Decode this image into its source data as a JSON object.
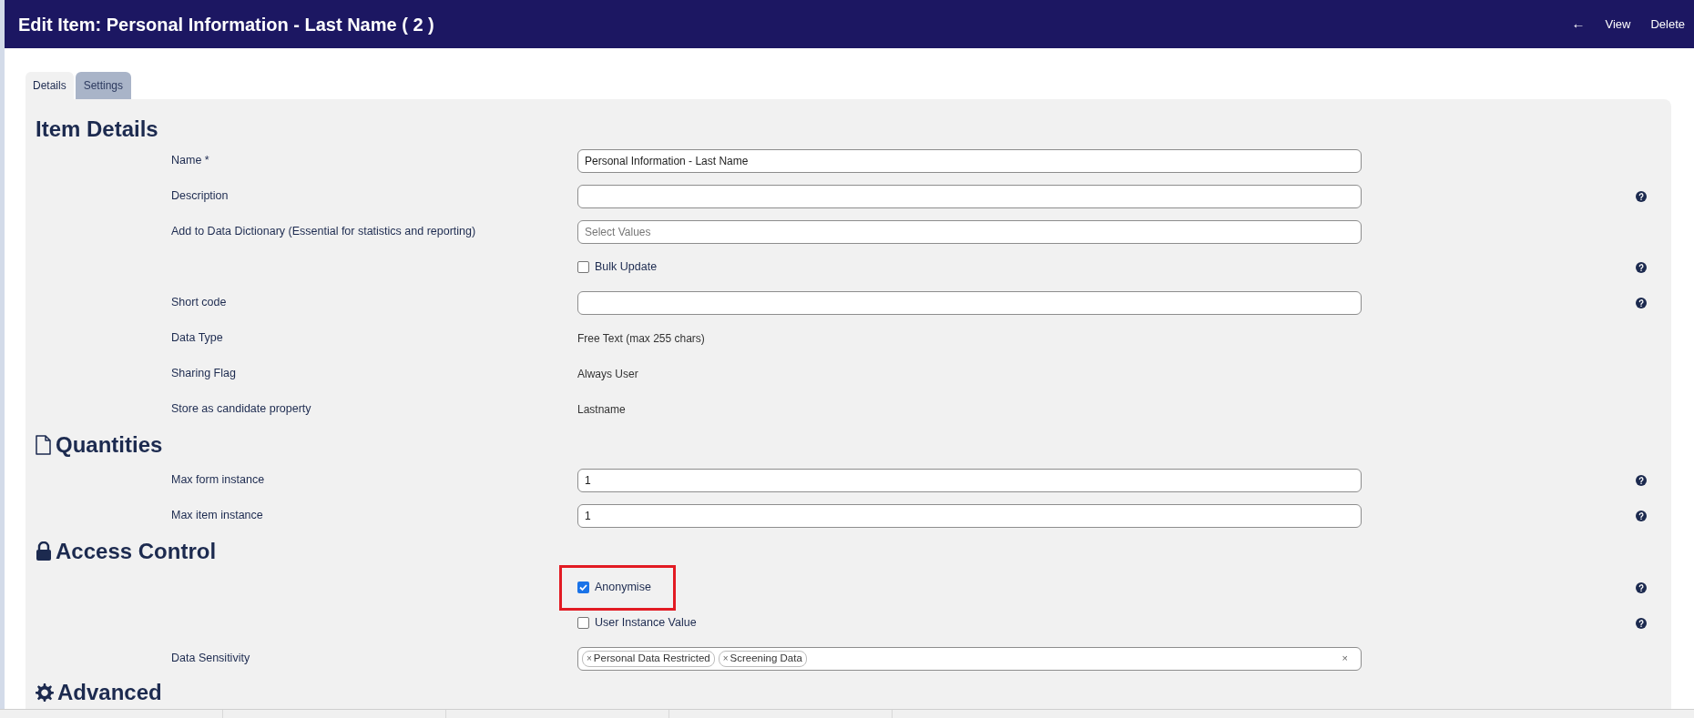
{
  "header": {
    "title": "Edit Item: Personal Information - Last Name ( 2 )",
    "back": "←",
    "actions": [
      "View",
      "Delete"
    ]
  },
  "tabs": [
    {
      "label": "Details",
      "selected": true
    },
    {
      "label": "Settings",
      "selected": false
    }
  ],
  "item_details": {
    "title": "Item Details",
    "rows": [
      {
        "kind": "input",
        "label": "Name *",
        "value": "Personal Information - Last Name",
        "help": false
      },
      {
        "kind": "input",
        "label": "Description",
        "help": true
      },
      {
        "kind": "input",
        "label": "Add to Data Dictionary (Essential for statistics and reporting)",
        "placeholder": "Select Values",
        "help": false
      },
      {
        "kind": "checkbox",
        "text": "Bulk Update",
        "checked": false,
        "help": true
      },
      {
        "kind": "input",
        "label": "Short code",
        "help": true
      },
      {
        "kind": "text",
        "label": "Data Type",
        "value": "Free Text (max 255 chars)",
        "help": false
      },
      {
        "kind": "text",
        "label": "Sharing Flag",
        "value": "Always User",
        "help": false
      },
      {
        "kind": "text",
        "label": "Store as candidate property",
        "value": "Lastname",
        "help": false
      }
    ]
  },
  "quantities": {
    "title": "Quantities",
    "rows": [
      {
        "kind": "input",
        "label": "Max form instance",
        "value": "1",
        "help": true
      },
      {
        "kind": "input",
        "label": "Max item instance",
        "value": "1",
        "help": true
      }
    ]
  },
  "access_control": {
    "title": "Access Control",
    "rows": [
      {
        "kind": "checkbox",
        "text": "Anonymise",
        "checked": true,
        "highlighted": true,
        "help": true
      },
      {
        "kind": "checkbox",
        "text": "User Instance Value",
        "checked": false,
        "highlighted": false,
        "help": true
      },
      {
        "kind": "tags",
        "label": "Data Sensitivity",
        "tags": [
          {
            "remove": "×",
            "text": "Personal Data Restricted"
          },
          {
            "remove": "×",
            "text": "Screening Data"
          }
        ],
        "clear": "×",
        "help": false
      }
    ]
  },
  "advanced": {
    "title": "Advanced"
  }
}
